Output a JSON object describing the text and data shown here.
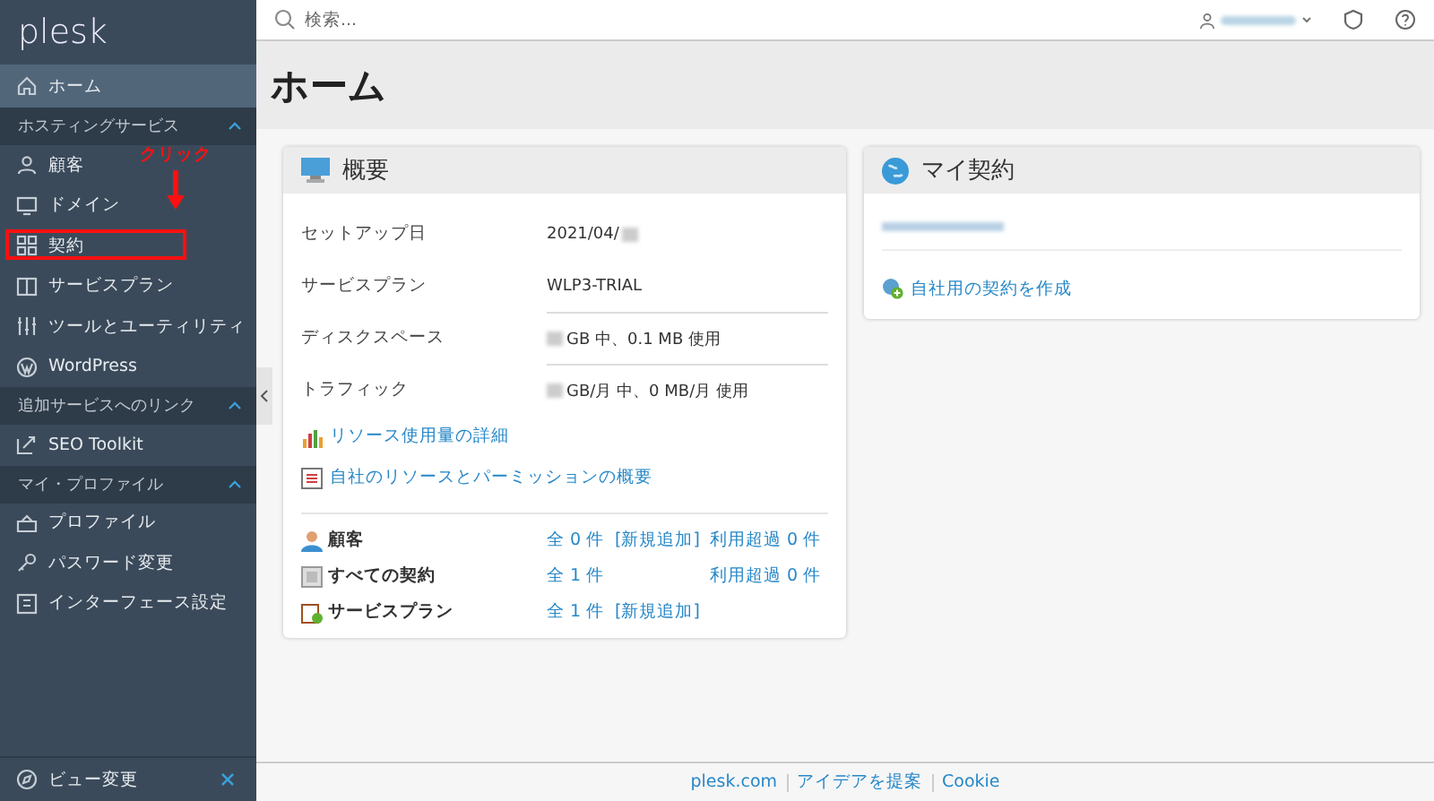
{
  "sidebar": {
    "logo": "plesk",
    "items": [
      {
        "kind": "item",
        "label": "ホーム",
        "selected": true,
        "annotated": false
      },
      {
        "kind": "section",
        "label": "ホスティングサービス",
        "expanded": true
      },
      {
        "kind": "item",
        "label": "顧客",
        "selected": false,
        "annotated": false
      },
      {
        "kind": "item",
        "label": "ドメイン",
        "selected": false,
        "annotated": false
      },
      {
        "kind": "item",
        "label": "契約",
        "selected": false,
        "annotated": true
      },
      {
        "kind": "item",
        "label": "サービスプラン",
        "selected": false,
        "annotated": false
      },
      {
        "kind": "item",
        "label": "ツールとユーティリティ",
        "selected": false,
        "annotated": false
      },
      {
        "kind": "item",
        "label": "WordPress",
        "selected": false,
        "annotated": false
      },
      {
        "kind": "section",
        "label": "追加サービスへのリンク",
        "expanded": true
      },
      {
        "kind": "item",
        "label": "SEO Toolkit",
        "selected": false,
        "annotated": false
      },
      {
        "kind": "section",
        "label": "マイ・プロファイル",
        "expanded": true
      },
      {
        "kind": "item",
        "label": "プロファイル",
        "selected": false,
        "annotated": false
      },
      {
        "kind": "item",
        "label": "パスワード変更",
        "selected": false,
        "annotated": false
      },
      {
        "kind": "item",
        "label": "インターフェース設定",
        "selected": false,
        "annotated": false
      }
    ],
    "footer": {
      "label": "ビュー変更"
    }
  },
  "annotation": {
    "text": "クリック"
  },
  "topbar": {
    "search": {
      "placeholder": "検索..."
    }
  },
  "page": {
    "title": "ホーム"
  },
  "overview": {
    "title": "概要",
    "info": [
      {
        "label": "セットアップ日",
        "value": "2021/04/",
        "divider_above": false
      },
      {
        "label": "サービスプラン",
        "value": "WLP3-TRIAL",
        "divider_above": false
      },
      {
        "label": "ディスクスペース",
        "value": "GB 中、0.1 MB 使用",
        "divider_above": true
      },
      {
        "label": "トラフィック",
        "value": "GB/月 中、0 MB/月 使用",
        "divider_above": true
      }
    ],
    "links": [
      "リソース使用量の詳細",
      "自社のリソースとパーミッションの概要"
    ],
    "summary": [
      {
        "label": "顧客",
        "total": "全 0 件",
        "add": "[新規追加]",
        "over": "利用超過 0 件"
      },
      {
        "label": "すべての契約",
        "total": "全 1 件",
        "over": "利用超過 0 件"
      },
      {
        "label": "サービスプラン",
        "total": "全 1 件",
        "add": "[新規追加]"
      }
    ]
  },
  "my_subscriptions": {
    "title": "マイ契約",
    "create_link": "自社用の契約を作成"
  },
  "footer": {
    "links": [
      "plesk.com",
      "アイデアを提案",
      "Cookie"
    ]
  }
}
